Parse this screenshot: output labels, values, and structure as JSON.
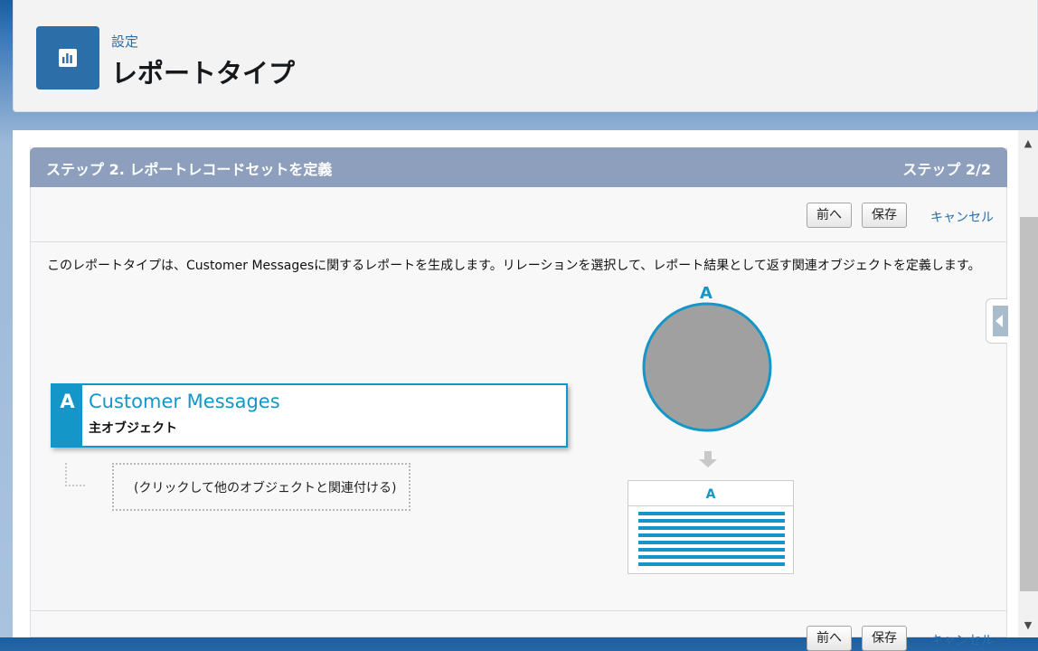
{
  "header": {
    "subtitle": "設定",
    "title": "レポートタイプ",
    "icon": "report-chart-icon"
  },
  "step": {
    "title": "ステップ 2. レポートレコードセットを定義",
    "count": "ステップ 2/2"
  },
  "buttons": {
    "previous": "前へ",
    "save": "保存",
    "cancel": "キャンセル"
  },
  "description": "このレポートタイプは、Customer Messagesに関するレポートを生成します。リレーションを選択して、レポート結果として返す関連オブジェクトを定義します。",
  "primary_object": {
    "letter": "A",
    "name": "Customer Messages",
    "role": "主オブジェクト"
  },
  "add_relation_text": "(クリックして他のオブジェクトと関連付ける)",
  "diagram": {
    "circle_label": "A",
    "table_label": "A"
  },
  "colors": {
    "accent": "#1596c8",
    "step_bar": "#8e9fbe",
    "header_icon": "#2b6ea8",
    "link": "#2b6ea8"
  }
}
